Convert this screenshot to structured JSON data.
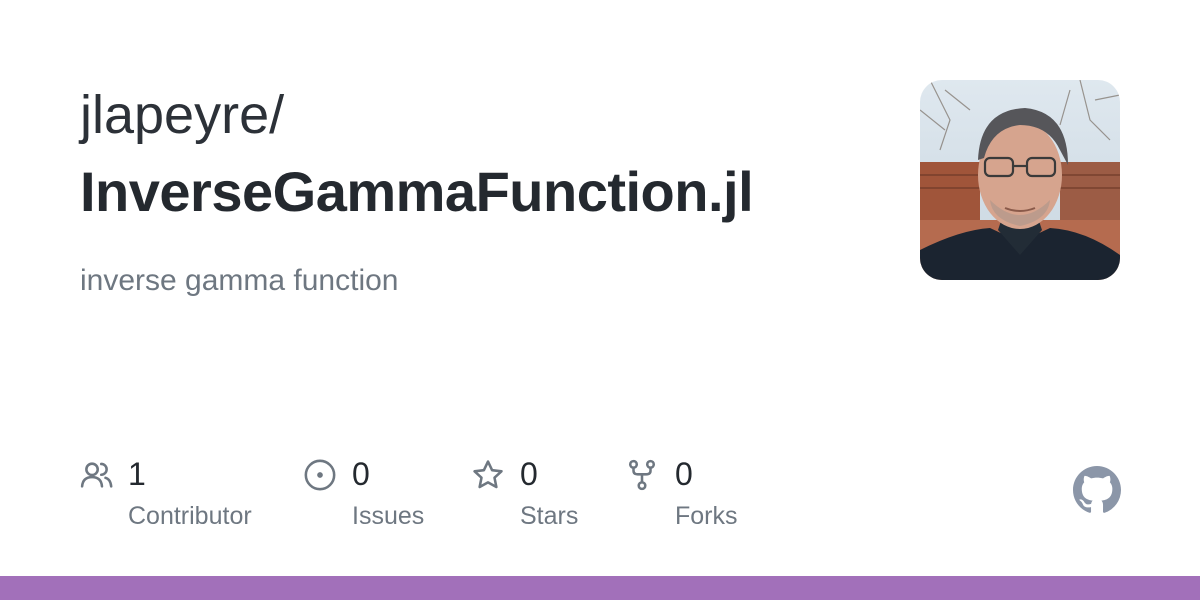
{
  "repo": {
    "owner": "jlapeyre/",
    "name": "InverseGammaFunction.jl",
    "description": "inverse gamma function"
  },
  "stats": [
    {
      "icon": "people-icon",
      "value": "1",
      "label": "Contributor"
    },
    {
      "icon": "issue-icon",
      "value": "0",
      "label": "Issues"
    },
    {
      "icon": "star-icon",
      "value": "0",
      "label": "Stars"
    },
    {
      "icon": "fork-icon",
      "value": "0",
      "label": "Forks"
    }
  ],
  "colors": {
    "language_bar": "#a270ba",
    "icon_gray": "#6e7781",
    "logo_gray": "#8b96a8"
  }
}
